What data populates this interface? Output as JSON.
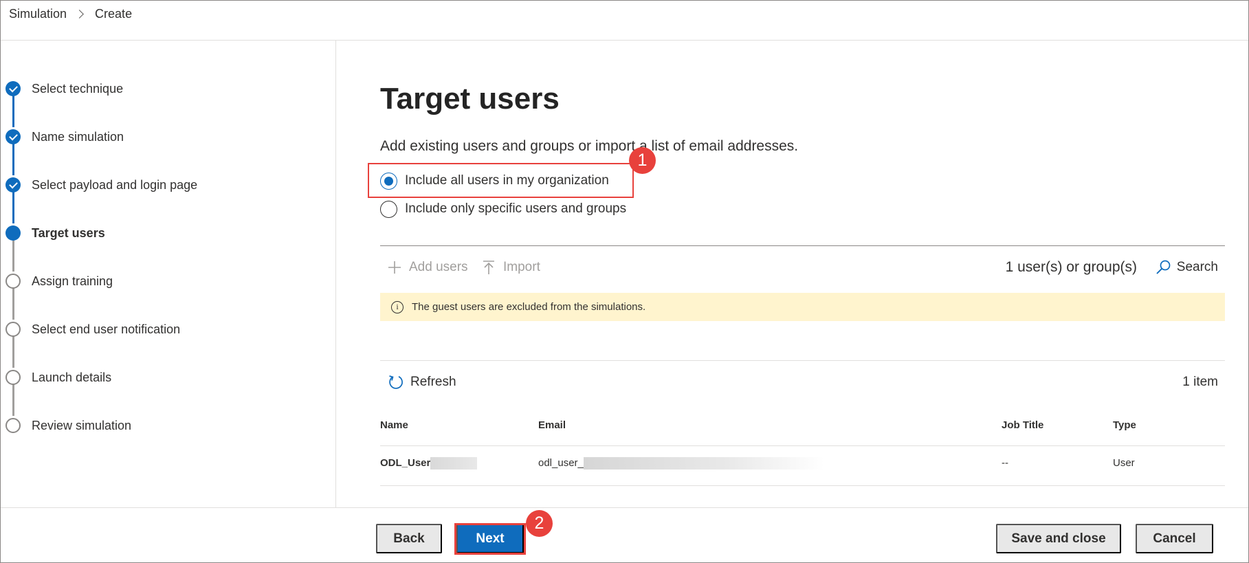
{
  "breadcrumb": {
    "root": "Simulation",
    "current": "Create"
  },
  "steps": [
    {
      "label": "Select technique",
      "state": "done"
    },
    {
      "label": "Name simulation",
      "state": "done"
    },
    {
      "label": "Select payload and login page",
      "state": "done"
    },
    {
      "label": "Target users",
      "state": "current"
    },
    {
      "label": "Assign training",
      "state": "todo"
    },
    {
      "label": "Select end user notification",
      "state": "todo"
    },
    {
      "label": "Launch details",
      "state": "todo"
    },
    {
      "label": "Review simulation",
      "state": "todo"
    }
  ],
  "main": {
    "title": "Target users",
    "description": "Add existing users and groups or import a list of email addresses.",
    "radio_all": "Include all users in my organization",
    "radio_specific": "Include only specific users and groups",
    "selected_option": "all"
  },
  "toolbar": {
    "add_users": "Add users",
    "import": "Import",
    "count": "1 user(s) or group(s)",
    "search": "Search"
  },
  "info_bar": {
    "message": "The guest users are excluded from the simulations."
  },
  "list": {
    "refresh": "Refresh",
    "item_count": "1 item",
    "columns": {
      "name": "Name",
      "email": "Email",
      "job_title": "Job Title",
      "type": "Type"
    },
    "rows": [
      {
        "name": "ODL_User",
        "email": "odl_user_",
        "job_title": "--",
        "type": "User"
      }
    ]
  },
  "annotations": {
    "badge1": "1",
    "badge2": "2",
    "highlight_color": "#e8413c"
  },
  "footer": {
    "back": "Back",
    "next": "Next",
    "save_close": "Save and close",
    "cancel": "Cancel"
  },
  "colors": {
    "accent": "#0f6cbd",
    "warning_bg": "#fff4ce"
  }
}
